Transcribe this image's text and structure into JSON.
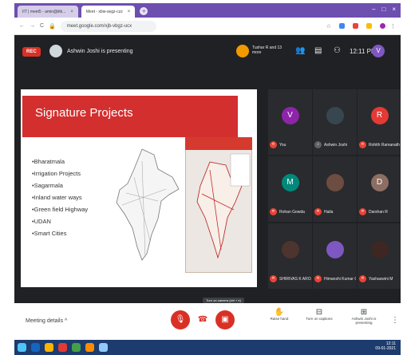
{
  "browser": {
    "tabs": [
      {
        "label": "IIT | meet5 - amin@iitk..."
      },
      {
        "label": "Meet - xbw-avgz-czz"
      }
    ],
    "url": "meet.google.com/xjb-vbgz-ucx"
  },
  "meeting": {
    "rec_label": "REC",
    "presenting": "Ashwin Joshi is presenting",
    "others": "Tushar R and 13 more",
    "time": "12:11 PM",
    "me_initial": "V"
  },
  "slide": {
    "title": "Signature Projects",
    "items": [
      "Bharatmala",
      "Irrigation Projects",
      "Sagarmala",
      "Inland water ways",
      "Green field Highway",
      "UDAN",
      "Smart Cities"
    ],
    "news_header": "NEW RIBBON"
  },
  "participants": [
    {
      "name": "You",
      "initial": "V",
      "color": "#8e24aa"
    },
    {
      "name": "Ashwin Joshi",
      "initial": "",
      "color": "#37474f"
    },
    {
      "name": "Rohith Ramanath",
      "initial": "R",
      "color": "#e53935"
    },
    {
      "name": "Rohan Gowda",
      "initial": "M",
      "color": "#00897b"
    },
    {
      "name": "Haila",
      "initial": "",
      "color": "#6d4c41"
    },
    {
      "name": "Darshan R",
      "initial": "D",
      "color": "#8d6e63"
    },
    {
      "name": "SHIRIVAS K AROJ",
      "initial": "",
      "color": "#4e342e"
    },
    {
      "name": "Himanshi Kumar Gil",
      "initial": "",
      "color": "#7e57c2"
    },
    {
      "name": "Yashaswini M",
      "initial": "",
      "color": "#3e2723"
    }
  ],
  "controls": {
    "details": "Meeting details",
    "chevron": "^",
    "tooltip": "Turn on camera (ctrl + e)",
    "raise_hand": "Raise hand",
    "captions": "Turn on captions",
    "present": "Ashwin Joshi is presenting"
  },
  "taskbar": {
    "time": "12:11",
    "date": "09-01-2021"
  }
}
